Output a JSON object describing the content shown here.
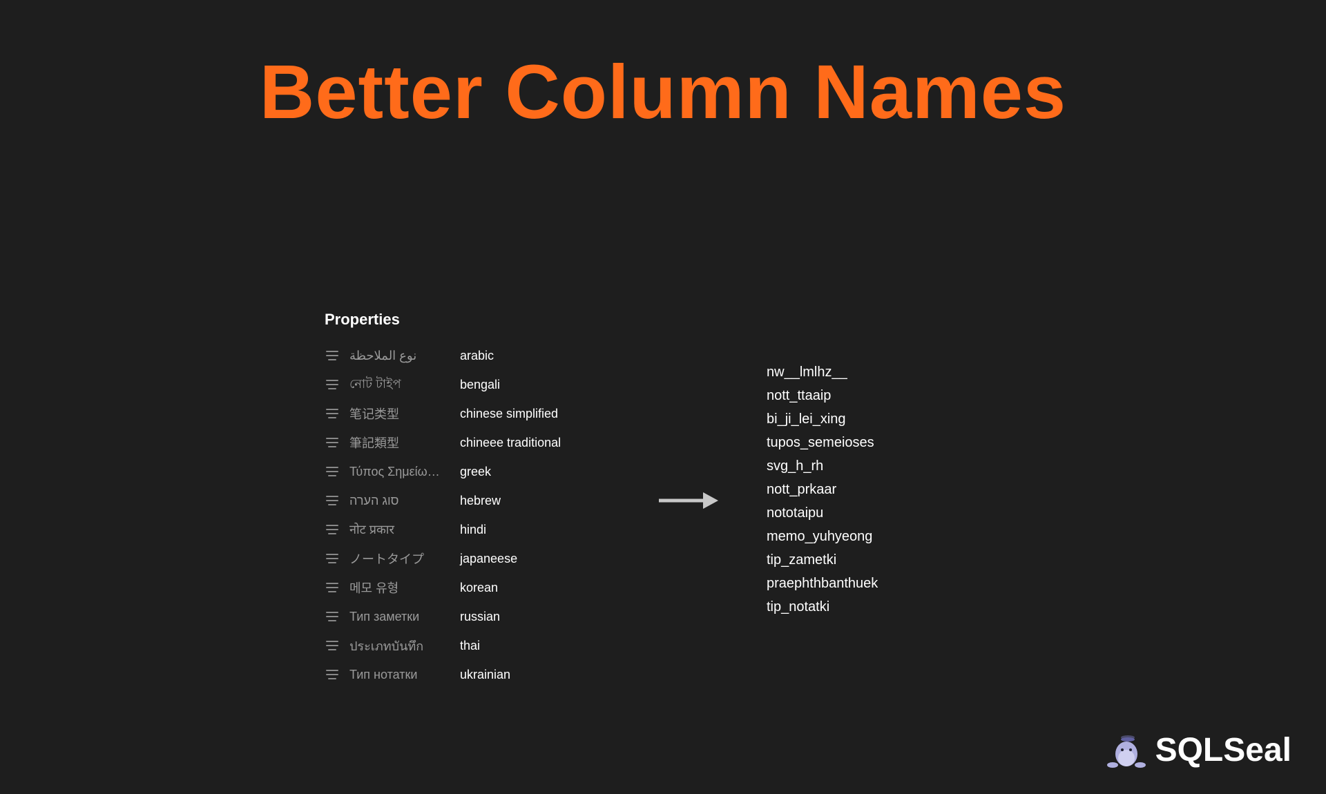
{
  "title": "Better Column Names",
  "panel_header": "Properties",
  "properties": [
    {
      "key": "نوع الملاحظة",
      "value": "arabic"
    },
    {
      "key": "নোট টাইপ",
      "value": "bengali"
    },
    {
      "key": "笔记类型",
      "value": "chinese simplified"
    },
    {
      "key": "筆記類型",
      "value": "chineee traditional"
    },
    {
      "key": "Τύπος Σημείω…",
      "value": "greek"
    },
    {
      "key": "סוג הערה",
      "value": "hebrew"
    },
    {
      "key": "नोट प्रकार",
      "value": "hindi"
    },
    {
      "key": "ノートタイプ",
      "value": "japaneese"
    },
    {
      "key": "메모 유형",
      "value": "korean"
    },
    {
      "key": "Тип заметки",
      "value": "russian"
    },
    {
      "key": "ประเภทบันทึก",
      "value": "thai"
    },
    {
      "key": "Тип нотатки",
      "value": "ukrainian"
    }
  ],
  "outputs": [
    "nw__lmlhz__",
    "nott_ttaaip",
    "bi_ji_lei_xing",
    "tupos_semeioses",
    "svg_h_rh",
    "nott_prkaar",
    "nototaipu",
    "memo_yuhyeong",
    "tip_zametki",
    "praephthbanthuek",
    "tip_notatki"
  ],
  "brand": "SQLSeal"
}
